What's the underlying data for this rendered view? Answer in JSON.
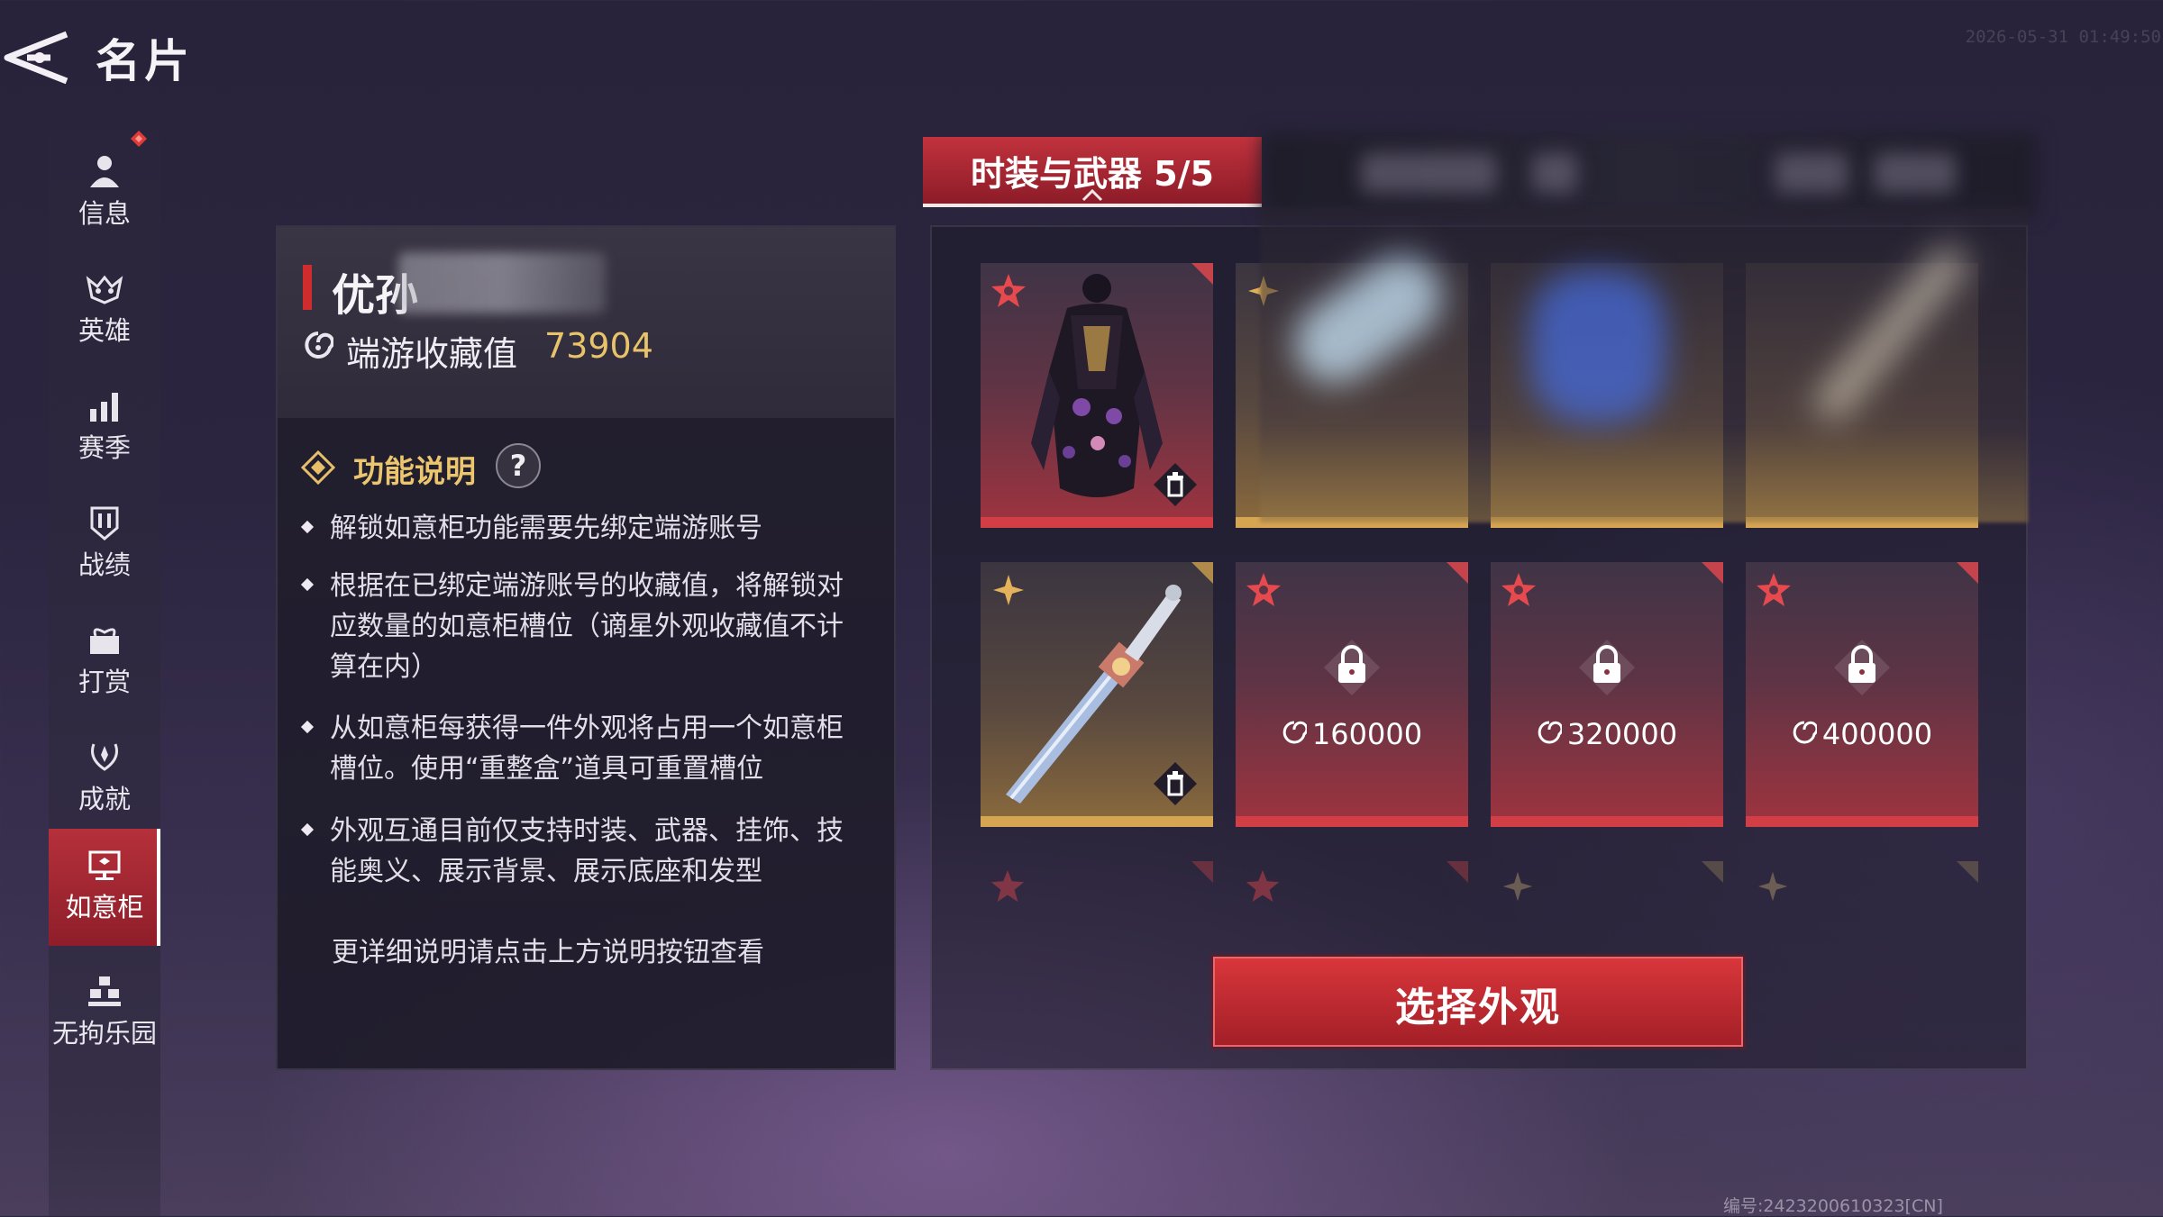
{
  "header": {
    "title": "名片",
    "back_icon": "back-arrow-icon",
    "timestamp": "2026-05-31 01:49:50"
  },
  "sidebar": {
    "items": [
      {
        "label": "信息",
        "icon": "person-icon"
      },
      {
        "label": "英雄",
        "icon": "hero-mask-icon"
      },
      {
        "label": "赛季",
        "icon": "bar-chart-icon"
      },
      {
        "label": "战绩",
        "icon": "shield-icon"
      },
      {
        "label": "打赏",
        "icon": "gift-icon"
      },
      {
        "label": "成就",
        "icon": "laurel-icon"
      },
      {
        "label": "如意柜",
        "icon": "cabinet-icon",
        "active": true
      },
      {
        "label": "无拘乐园",
        "icon": "park-icon"
      }
    ],
    "badge_color": "#e23a3a"
  },
  "info": {
    "name": "优孙",
    "collection_label": "端游收藏值",
    "collection_value": "73904",
    "function_title": "功能说明",
    "help_label": "?",
    "bullets": [
      "解锁如意柜功能需要先绑定端游账号",
      "根据在已绑定端游账号的收藏值，将解锁对应数量的如意柜槽位（谪星外观收藏值不计算在内）",
      "从如意柜每获得一件外观将占用一个如意柜槽位。使用“重整盒”道具可重置槽位",
      "外观互通目前仅支持时装、武器、挂饰、技能奥义、展示背景、展示底座和发型"
    ],
    "footnote": "更详细说明请点击上方说明按钮查看"
  },
  "tab": {
    "label": "时装与武器 5/5"
  },
  "slots": {
    "locked_costs": [
      "160000",
      "320000",
      "400000"
    ],
    "item_names": [
      "outfit-slot",
      "weapon-slot"
    ]
  },
  "action": {
    "select_label": "选择外观"
  },
  "footer": {
    "serial": "编号:2423200610323[CN]"
  },
  "colors": {
    "accent_red": "#c1323d",
    "gold": "#e8c36a",
    "rarity_red": "#d13e46",
    "rarity_gold": "#d6a552"
  }
}
